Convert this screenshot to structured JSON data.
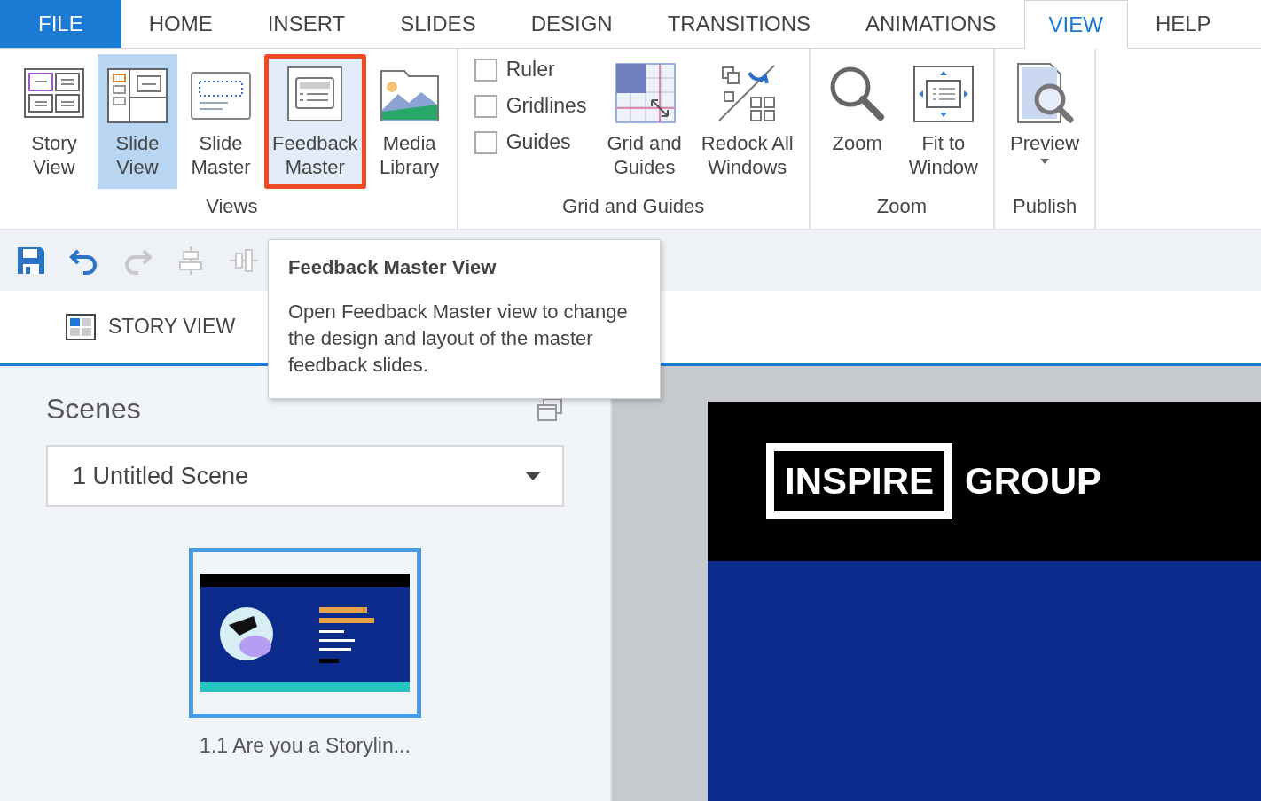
{
  "menu_tabs": [
    {
      "label": "FILE",
      "kind": "file",
      "selected": false
    },
    {
      "label": "HOME",
      "kind": "tab",
      "selected": false
    },
    {
      "label": "INSERT",
      "kind": "tab",
      "selected": false
    },
    {
      "label": "SLIDES",
      "kind": "tab",
      "selected": false
    },
    {
      "label": "DESIGN",
      "kind": "tab",
      "selected": false
    },
    {
      "label": "TRANSITIONS",
      "kind": "tab",
      "selected": false
    },
    {
      "label": "ANIMATIONS",
      "kind": "tab",
      "selected": false
    },
    {
      "label": "VIEW",
      "kind": "tab",
      "selected": true
    },
    {
      "label": "HELP",
      "kind": "tab",
      "selected": false
    }
  ],
  "ribbon": {
    "groups": [
      {
        "label": "Views",
        "items": [
          {
            "kind": "button",
            "lines": [
              "Story",
              "View"
            ],
            "selected": false,
            "highlighted": false
          },
          {
            "kind": "button",
            "lines": [
              "Slide",
              "View"
            ],
            "selected": true,
            "highlighted": false
          },
          {
            "kind": "button",
            "lines": [
              "Slide",
              "Master"
            ],
            "selected": false,
            "highlighted": false
          },
          {
            "kind": "button",
            "lines": [
              "Feedback",
              "Master"
            ],
            "selected": false,
            "highlighted": true
          },
          {
            "kind": "button",
            "lines": [
              "Media",
              "Library"
            ],
            "selected": false,
            "highlighted": false
          }
        ]
      },
      {
        "label": "Grid and Guides",
        "items": [
          {
            "kind": "checks",
            "checks": [
              {
                "label": "Ruler",
                "checked": false
              },
              {
                "label": "Gridlines",
                "checked": false
              },
              {
                "label": "Guides",
                "checked": false
              }
            ]
          },
          {
            "kind": "button",
            "lines": [
              "Grid and",
              "Guides"
            ],
            "selected": false,
            "highlighted": false
          },
          {
            "kind": "button",
            "lines": [
              "Redock All",
              "Windows"
            ],
            "selected": false,
            "highlighted": false
          }
        ]
      },
      {
        "label": "Zoom",
        "items": [
          {
            "kind": "button",
            "lines": [
              "Zoom"
            ],
            "selected": false,
            "highlighted": false
          },
          {
            "kind": "button",
            "lines": [
              "Fit to",
              "Window"
            ],
            "selected": false,
            "highlighted": false
          }
        ]
      },
      {
        "label": "Publish",
        "items": [
          {
            "kind": "dropbutton",
            "lines": [
              "Preview"
            ],
            "selected": false,
            "highlighted": false
          }
        ]
      }
    ]
  },
  "quick_access": [
    {
      "disabled": false
    },
    {
      "disabled": false
    },
    {
      "disabled": true
    },
    {
      "disabled": true
    },
    {
      "disabled": true
    }
  ],
  "tooltip": {
    "title": "Feedback Master View",
    "text": "Open Feedback Master view to change the design and layout of the master feedback slides."
  },
  "view_tab": {
    "label": "STORY VIEW",
    "selected": true
  },
  "scenes": {
    "title": "Scenes",
    "scene_select": "1 Untitled Scene",
    "slides": [
      {
        "caption": "1.1 Are you a Storylin...",
        "selected": true
      }
    ]
  },
  "slide": {
    "logo_boxed": "INSPIRE",
    "logo_text": "GROUP"
  }
}
